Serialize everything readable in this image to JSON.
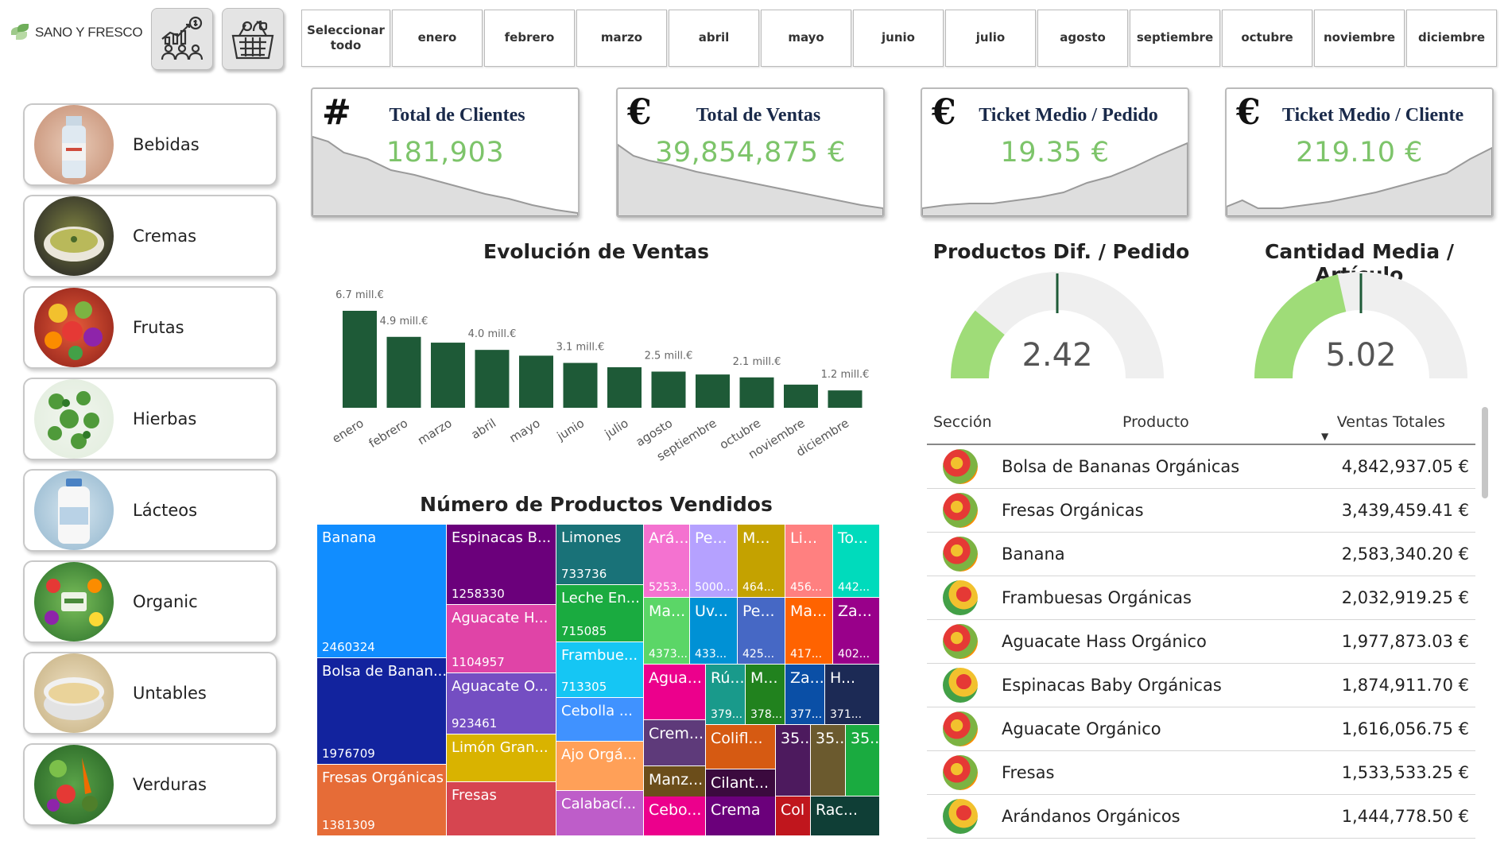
{
  "brand": {
    "name": "SANO Y FRESCO"
  },
  "toolbar": {
    "icons": [
      "clientes-stats-icon",
      "basket-icon"
    ]
  },
  "months": {
    "select_all": "Seleccionar todo",
    "items": [
      "enero",
      "febrero",
      "marzo",
      "abril",
      "mayo",
      "junio",
      "julio",
      "agosto",
      "septiembre",
      "octubre",
      "noviembre",
      "diciembre"
    ]
  },
  "categories": [
    {
      "label": "Bebidas",
      "color": "#d9b3a0"
    },
    {
      "label": "Cremas",
      "color": "#6f7b3e"
    },
    {
      "label": "Frutas",
      "color": "#d94a2e"
    },
    {
      "label": "Hierbas",
      "color": "#5fa348"
    },
    {
      "label": "Lácteos",
      "color": "#aacbe0"
    },
    {
      "label": "Organic",
      "color": "#4f9f47"
    },
    {
      "label": "Untables",
      "color": "#e7c98a"
    },
    {
      "label": "Verduras",
      "color": "#3f8a3a"
    }
  ],
  "kpis": [
    {
      "symbol": "#",
      "title": "Total de Clientes",
      "value": "181,903"
    },
    {
      "symbol": "€",
      "title": "Total de Ventas",
      "value": "39,854,875 €"
    },
    {
      "symbol": "€",
      "title": "Ticket Medio / Pedido",
      "value": "19.35 €"
    },
    {
      "symbol": "€",
      "title": "Ticket Medio / Cliente",
      "value": "219.10 €"
    }
  ],
  "sales_title": "Evolución de Ventas",
  "chart_data": {
    "type": "bar",
    "categories": [
      "enero",
      "febrero",
      "marzo",
      "abril",
      "mayo",
      "junio",
      "julio",
      "agosto",
      "septiembre",
      "octubre",
      "noviembre",
      "diciembre"
    ],
    "values": [
      6.7,
      4.9,
      4.5,
      4.0,
      3.6,
      3.1,
      2.8,
      2.5,
      2.3,
      2.1,
      1.6,
      1.2
    ],
    "data_labels": [
      "6.7 mill.€",
      "4.9 mill.€",
      "",
      "4.0 mill.€",
      "",
      "3.1 mill.€",
      "",
      "2.5 mill.€",
      "",
      "2.1 mill.€",
      "",
      "1.2 mill.€"
    ],
    "color": "#1e5a37",
    "ylim": [
      0,
      7
    ]
  },
  "gauges": [
    {
      "title": "Productos Dif. / Pedido",
      "value": "2.42",
      "fill_fraction": 0.22
    },
    {
      "title": "Cantidad Media / Artículo",
      "value": "5.02",
      "fill_fraction": 0.43
    }
  ],
  "table": {
    "headers": {
      "section": "Sección",
      "product": "Producto",
      "sales": "Ventas Totales"
    },
    "rows": [
      {
        "product": "Bolsa de Bananas Orgánicas",
        "sales": "4,842,937.05 €"
      },
      {
        "product": "Fresas Orgánicas",
        "sales": "3,439,459.41 €"
      },
      {
        "product": "Banana",
        "sales": "2,583,340.20 €"
      },
      {
        "product": "Frambuesas Orgánicas",
        "sales": "2,032,919.25 €"
      },
      {
        "product": "Aguacate Hass Orgánico",
        "sales": "1,977,873.03 €"
      },
      {
        "product": "Espinacas Baby Orgánicas",
        "sales": "1,874,911.70 €"
      },
      {
        "product": "Aguacate Orgánico",
        "sales": "1,616,056.75 €"
      },
      {
        "product": "Fresas",
        "sales": "1,533,533.25 €"
      },
      {
        "product": "Arándanos Orgánicos",
        "sales": "1,444,778.50 €"
      }
    ]
  },
  "treemap": {
    "title": "Número de Productos Vendidos",
    "tiles": [
      {
        "name": "Banana",
        "value": "2460324",
        "color": "#118dff"
      },
      {
        "name": "Bolsa de Banan...",
        "value": "1976709",
        "color": "#12239e"
      },
      {
        "name": "Fresas Orgánicas",
        "value": "1381309",
        "color": "#e66c37"
      },
      {
        "name": "Espinacas B...",
        "value": "1258330",
        "color": "#6b007b"
      },
      {
        "name": "Aguacate H...",
        "value": "1104957",
        "color": "#e044a7"
      },
      {
        "name": "Aguacate O...",
        "value": "923461",
        "color": "#744ec2"
      },
      {
        "name": "Limón Gran...",
        "value": "",
        "color": "#d9b300"
      },
      {
        "name": "Fresas",
        "value": "",
        "color": "#d64550"
      },
      {
        "name": "Limones",
        "value": "733736",
        "color": "#197278"
      },
      {
        "name": "Leche En...",
        "value": "715085",
        "color": "#1aab40"
      },
      {
        "name": "Frambue...",
        "value": "713305",
        "color": "#15c6f4"
      },
      {
        "name": "Cebolla ...",
        "value": "",
        "color": "#4092ff"
      },
      {
        "name": "Ajo Orgá...",
        "value": "",
        "color": "#ffa058"
      },
      {
        "name": "Calabací...",
        "value": "",
        "color": "#be5dc9"
      },
      {
        "name": "Ará...",
        "value": "5253...",
        "color": "#f472d0"
      },
      {
        "name": "Pe...",
        "value": "5000...",
        "color": "#b5a1ff"
      },
      {
        "name": "M...",
        "value": "464...",
        "color": "#c4a200"
      },
      {
        "name": "Li...",
        "value": "456...",
        "color": "#ff8080"
      },
      {
        "name": "To...",
        "value": "442...",
        "color": "#00dbbc"
      },
      {
        "name": "Ma...",
        "value": "4373...",
        "color": "#5bd667"
      },
      {
        "name": "Uv...",
        "value": "433...",
        "color": "#0091d5"
      },
      {
        "name": "Pe...",
        "value": "425...",
        "color": "#4668c5"
      },
      {
        "name": "Ma...",
        "value": "417...",
        "color": "#ff6300"
      },
      {
        "name": "Za...",
        "value": "402...",
        "color": "#99008a"
      },
      {
        "name": "Agua...",
        "value": "",
        "color": "#ec008c"
      },
      {
        "name": "Rú...",
        "value": "379...",
        "color": "#199a8b"
      },
      {
        "name": "M...",
        "value": "378...",
        "color": "#21821e"
      },
      {
        "name": "Za...",
        "value": "377...",
        "color": "#0a4fa6"
      },
      {
        "name": "H...",
        "value": "371...",
        "color": "#1c2a55"
      },
      {
        "name": "Crem...",
        "value": "",
        "color": "#5e3a7a"
      },
      {
        "name": "Colifl...",
        "value": "",
        "color": "#d65a12"
      },
      {
        "name": "35...",
        "value": "",
        "color": "#4d1a5e"
      },
      {
        "name": "35...",
        "value": "",
        "color": "#6b5a2e"
      },
      {
        "name": "35...",
        "value": "",
        "color": "#1aab40"
      },
      {
        "name": "Manz...",
        "value": "",
        "color": "#6b4d1a"
      },
      {
        "name": "Cilant...",
        "value": "",
        "color": "#3b0a3e"
      },
      {
        "name": "Cebo...",
        "value": "",
        "color": "#ec008c"
      },
      {
        "name": "Crema",
        "value": "",
        "color": "#6b007b"
      },
      {
        "name": "Col ...",
        "value": "",
        "color": "#c0161d"
      },
      {
        "name": "Rac...",
        "value": "",
        "color": "#0f3e36"
      }
    ]
  }
}
